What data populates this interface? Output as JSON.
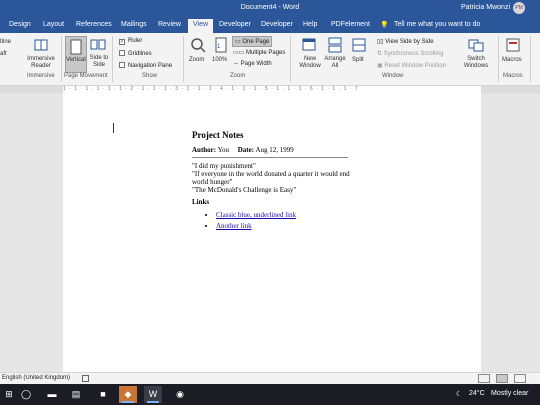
{
  "window": {
    "title": "Document4 - Word",
    "user": "Patricia Mwonzi",
    "avatar": "PM"
  },
  "tabs": [
    {
      "label": "Design"
    },
    {
      "label": "Layout"
    },
    {
      "label": "References"
    },
    {
      "label": "Mailings"
    },
    {
      "label": "Review"
    },
    {
      "label": "View"
    },
    {
      "label": "Developer"
    },
    {
      "label": "Developer"
    },
    {
      "label": "Help"
    },
    {
      "label": "PDFelement"
    }
  ],
  "tell_me": "Tell me what you want to do",
  "ribbon": {
    "outline_fragment": "tline",
    "draft_fragment": "aft",
    "immersive_reader": "Immersive Reader",
    "vertical": "Vertical",
    "side_to_side": "Side to Side",
    "ruler": "Ruler",
    "gridlines": "Gridlines",
    "navigation_pane": "Navigation Pane",
    "zoom": "Zoom",
    "zoom100": "100%",
    "one_page": "One Page",
    "multiple_pages": "Multiple Pages",
    "page_width": "Page Width",
    "new_window": "New Window",
    "arrange_all": "Arrange All",
    "split": "Split",
    "view_side_by_side": "View Side by Side",
    "sync_scrolling": "Synchronous Scrolling",
    "reset_window": "Reset Window Position",
    "switch_windows": "Switch Windows",
    "macros": "Macros",
    "groups": {
      "immersive": "Immersive",
      "page_movement": "Page Movement",
      "show": "Show",
      "zoom": "Zoom",
      "window": "Window",
      "macros": "Macros"
    },
    "checks": {
      "ruler": true,
      "gridlines": false,
      "navigation_pane": false
    }
  },
  "ruler": {
    "marks": "1 · 1 · 1 · 1 · 1 · 1 · 2 · 1 · 1 · 1 · 3 · 1 · 1 · 1 · 4 · 1 · 1 · 1 · 5 · 1 · 1 · 1 · 6 · 1 · 1 · 1 · 7"
  },
  "document": {
    "title": "Project Notes",
    "author_label": "Author:",
    "author": "You",
    "date_label": "Date:",
    "date": "Aug 12, 1999",
    "quotes": [
      "\"I did my punishment\"",
      "\"If everyone in the world donated a quarter it would end world hunger\"",
      "\"The McDonald's Challenge is Easy\""
    ],
    "links_heading": "Links",
    "links": [
      "Classic blue, underlined link",
      "Another link"
    ]
  },
  "status": {
    "language": "English (United Kingdom)"
  },
  "taskbar": {
    "weather_temp": "24°C",
    "weather_text": "Mostly clear"
  },
  "colors": {
    "word_blue": "#2b579a",
    "link": "#1a0dab"
  }
}
